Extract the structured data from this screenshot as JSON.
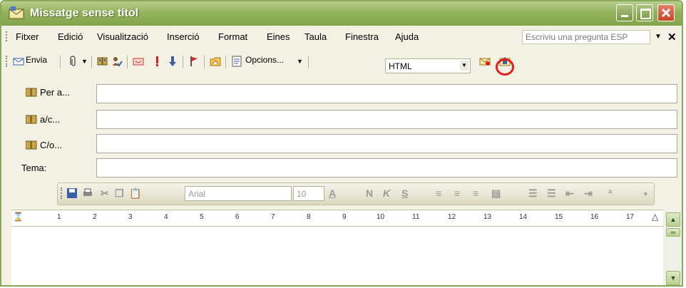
{
  "window": {
    "title": "Missatge sense títol",
    "controls": [
      "minimize",
      "maximize",
      "close"
    ]
  },
  "menubar": {
    "items": [
      {
        "label": "Fitxer"
      },
      {
        "label": "Edició"
      },
      {
        "label": "Visualització"
      },
      {
        "label": "Inserció"
      },
      {
        "label": "Format"
      },
      {
        "label": "Eines"
      },
      {
        "label": "Taula"
      },
      {
        "label": "Finestra"
      },
      {
        "label": "Ajuda"
      }
    ],
    "ask_placeholder": "Escriviu una pregunta ESP"
  },
  "toolbar": {
    "send_label": "Envia",
    "options_label": "Opcions...",
    "format_value": "HTML",
    "icons": [
      "send-icon",
      "attach-icon",
      "address-book-icon",
      "check-names-icon",
      "flag-importance-icon",
      "high-importance-icon",
      "low-importance-icon",
      "follow-up-flag-icon",
      "options-folder-icon",
      "options-page-icon",
      "envelope-sign-icon",
      "envelope-encrypt-icon"
    ]
  },
  "header": {
    "to_label": "Per a...",
    "cc_label": "a/c...",
    "bcc_label": "C/o...",
    "subject_label": "Tema:"
  },
  "formatting": {
    "font_name": "Arial",
    "font_size": "10",
    "bold_glyph": "N",
    "italic_glyph": "K",
    "underline_glyph": "S"
  },
  "ruler": {
    "numbers": [
      "1",
      "2",
      "3",
      "4",
      "5",
      "6",
      "7",
      "8",
      "9",
      "10",
      "11",
      "12",
      "13",
      "14",
      "15",
      "16",
      "17"
    ]
  },
  "colors": {
    "title_bar": "#93b25c",
    "close_button": "#c84227",
    "highlight_ring": "#e0201c",
    "window_bg": "#f3f1e4"
  }
}
